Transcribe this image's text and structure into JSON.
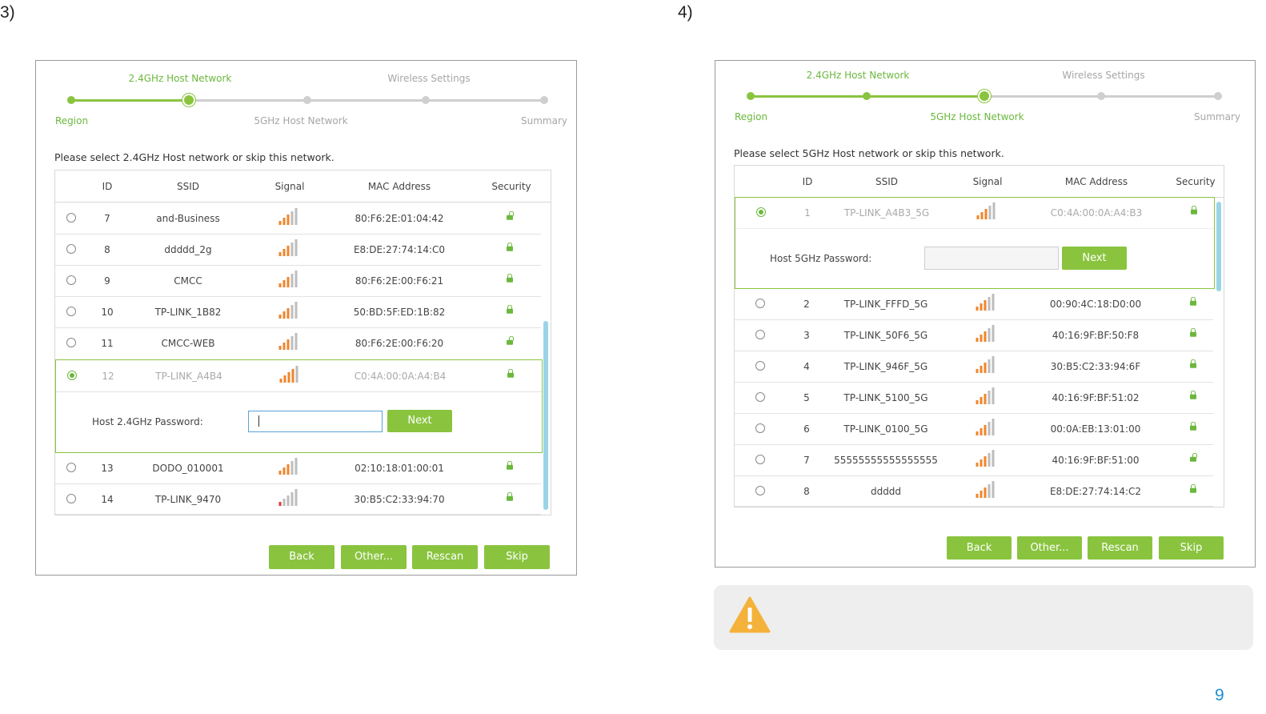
{
  "page": {
    "step_left": "3)",
    "step_right": "4)",
    "page_number": "9",
    "accent_green": "#8ac43f",
    "signal_orange": "#f0842a",
    "link_blue": "#1b8fd0"
  },
  "left": {
    "stepper": {
      "top_labels": [
        "2.4GHz Host Network",
        "Wireless Settings"
      ],
      "bottom_labels": [
        "Region",
        "5GHz Host Network",
        "Summary"
      ],
      "current_step": 2
    },
    "prompt": "Please select 2.4GHz Host network or skip this network.",
    "columns": [
      "ID",
      "SSID",
      "Signal",
      "MAC Address",
      "Security"
    ],
    "rows": [
      {
        "id": "7",
        "ssid": "and-Business",
        "mac": "80:F6:2E:01:04:42",
        "security": "open",
        "signal": 3
      },
      {
        "id": "8",
        "ssid": "ddddd_2g",
        "mac": "E8:DE:27:74:14:C0",
        "security": "locked",
        "signal": 3
      },
      {
        "id": "9",
        "ssid": "CMCC",
        "mac": "80:F6:2E:00:F6:21",
        "security": "locked",
        "signal": 3
      },
      {
        "id": "10",
        "ssid": "TP-LINK_1B82",
        "mac": "50:BD:5F:ED:1B:82",
        "security": "locked",
        "signal": 3
      },
      {
        "id": "11",
        "ssid": "CMCC-WEB",
        "mac": "80:F6:2E:00:F6:20",
        "security": "open",
        "signal": 3
      },
      {
        "id": "12",
        "ssid": "TP-LINK_A4B4",
        "mac": "C0:4A:00:0A:A4:B4",
        "security": "locked",
        "signal": 4
      },
      {
        "id": "13",
        "ssid": "DODO_010001",
        "mac": "02:10:18:01:00:01",
        "security": "locked",
        "signal": 3
      },
      {
        "id": "14",
        "ssid": "TP-LINK_9470",
        "mac": "30:B5:C2:33:94:70",
        "security": "locked",
        "signal": 1
      }
    ],
    "selected_id": "12",
    "password_label": "Host 2.4GHz Password:",
    "password_value": "",
    "next_label": "Next",
    "buttons": [
      "Back",
      "Other...",
      "Rescan",
      "Skip"
    ]
  },
  "right": {
    "stepper": {
      "top_labels": [
        "2.4GHz Host Network",
        "Wireless Settings"
      ],
      "bottom_labels": [
        "Region",
        "5GHz Host Network",
        "Summary"
      ],
      "current_step": 3
    },
    "prompt": "Please select 5GHz Host network or skip this network.",
    "columns": [
      "ID",
      "SSID",
      "Signal",
      "MAC Address",
      "Security"
    ],
    "rows": [
      {
        "id": "1",
        "ssid": "TP-LINK_A4B3_5G",
        "mac": "C0:4A:00:0A:A4:B3",
        "security": "locked",
        "signal": 3
      },
      {
        "id": "2",
        "ssid": "TP-LINK_FFFD_5G",
        "mac": "00:90:4C:18:D0:00",
        "security": "locked",
        "signal": 3
      },
      {
        "id": "3",
        "ssid": "TP-LINK_50F6_5G",
        "mac": "40:16:9F:BF:50:F8",
        "security": "locked",
        "signal": 3
      },
      {
        "id": "4",
        "ssid": "TP-LINK_946F_5G",
        "mac": "30:B5:C2:33:94:6F",
        "security": "locked",
        "signal": 3
      },
      {
        "id": "5",
        "ssid": "TP-LINK_5100_5G",
        "mac": "40:16:9F:BF:51:02",
        "security": "locked",
        "signal": 3
      },
      {
        "id": "6",
        "ssid": "TP-LINK_0100_5G",
        "mac": "00:0A:EB:13:01:00",
        "security": "locked",
        "signal": 3
      },
      {
        "id": "7",
        "ssid": "55555555555555555",
        "mac": "40:16:9F:BF:51:00",
        "security": "open",
        "signal": 3
      },
      {
        "id": "8",
        "ssid": "ddddd",
        "mac": "E8:DE:27:74:14:C2",
        "security": "locked",
        "signal": 3
      }
    ],
    "selected_id": "1",
    "password_label": "Host 5GHz Password:",
    "password_value": "",
    "next_label": "Next",
    "buttons": [
      "Back",
      "Other...",
      "Rescan",
      "Skip"
    ]
  },
  "note": {
    "icon": "warning-icon",
    "icon_color": "#f4b23a"
  }
}
